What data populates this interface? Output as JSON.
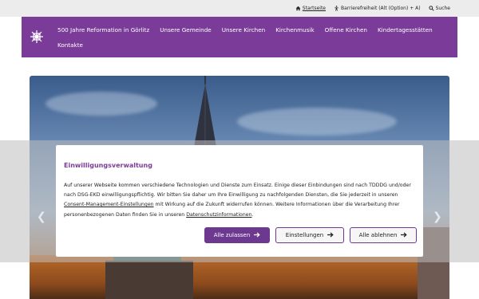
{
  "topbar": {
    "home": "Startseite",
    "accessibility": "Barrierefreiheit (Alt (Option) + A)",
    "search": "Suche"
  },
  "nav": {
    "items": [
      "500 Jahre Reformation in Görlitz",
      "Unsere Gemeinde",
      "Unsere Kirchen",
      "Kirchenmusik",
      "Offene Kirchen",
      "Kindertagesstätten",
      "Kontakte"
    ]
  },
  "consent": {
    "title": "Einwilligungsverwaltung",
    "text_1": "Auf unserer Webseite kommen verschiedene Technologien und Dienste zum Einsatz. Einige dieser Einbindungen sind nach TDDDG und/oder nach DSG-EKD einwilligungspflichtig. Wir bitten Sie daher um Ihre Einwilligung zu nachfolgenden Diensten, die Sie jederzeit in unseren ",
    "link_1": "Consent-Management-Einstellungen",
    "text_2": " mit Wirkung auf die Zukunft widerrufen können. Weitere Informationen über die Verarbeitung Ihrer personenbezogenen Daten finden Sie in unseren ",
    "link_2": "Datenschutzinformationen",
    "text_3": ".",
    "accept": "Alle zulassen",
    "settings": "Einstellungen",
    "reject": "Alle ablehnen"
  },
  "colors": {
    "brand": "#7b3c99",
    "button": "#6d3990"
  }
}
